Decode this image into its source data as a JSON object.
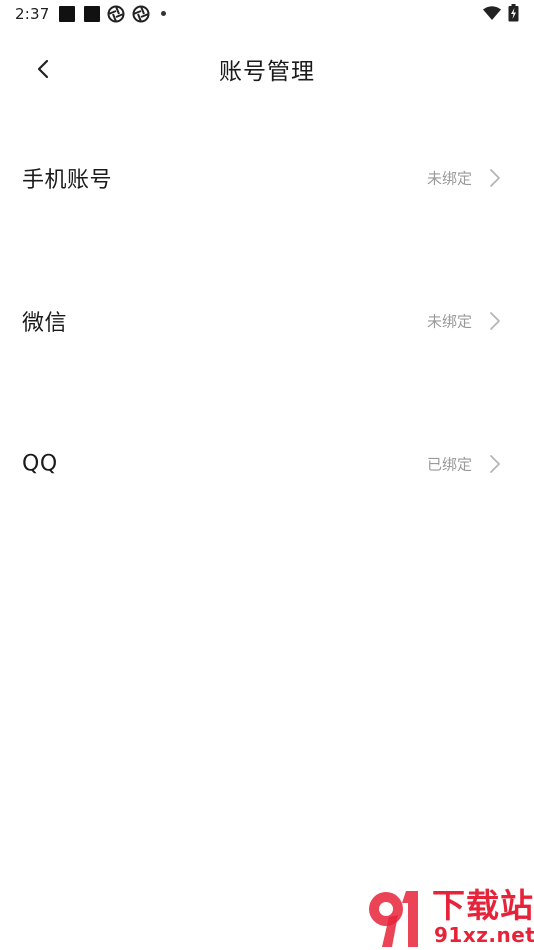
{
  "status_bar": {
    "time": "2:37",
    "icons": [
      "notification-square-icon",
      "notification-square-icon",
      "aperture-icon",
      "aperture-icon",
      "dot-icon",
      "wifi-icon",
      "battery-charging-icon"
    ]
  },
  "header": {
    "back_icon": "chevron-left-icon",
    "title": "账号管理"
  },
  "accounts": [
    {
      "label": "手机账号",
      "status": "未绑定",
      "chevron_icon": "chevron-right-icon"
    },
    {
      "label": "微信",
      "status": "未绑定",
      "chevron_icon": "chevron-right-icon"
    },
    {
      "label": "QQ",
      "status": "已绑定",
      "chevron_icon": "chevron-right-icon"
    }
  ],
  "watermark": {
    "title": "下载站",
    "domain": "91xz.net",
    "color": "#e7233a"
  },
  "colors": {
    "background": "#ffffff",
    "text_primary": "#1b1b1b",
    "text_secondary": "#9a9a9a",
    "chevron": "#b5b5b5"
  }
}
